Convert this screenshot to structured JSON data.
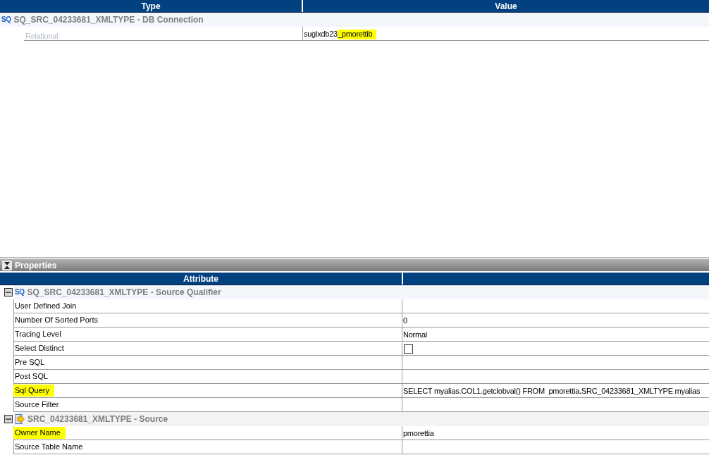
{
  "connections_panel": {
    "columns": [
      "Type",
      "Value"
    ],
    "groups": [
      {
        "kind": "qualifier",
        "icon_text": "SQ",
        "title": "SQ_SRC_04233681_XMLTYPE - DB Connection",
        "rows": [
          {
            "type": "Relational",
            "disabled": true,
            "value_parts": [
              {
                "text": "suglxdb23",
                "highlighted": false
              },
              {
                "text": "_pmorettib",
                "highlighted": true
              }
            ]
          }
        ]
      }
    ]
  },
  "properties_panel": {
    "title": "Properties",
    "columns": [
      "Attribute"
    ],
    "groups": [
      {
        "kind": "qualifier",
        "icon_text": "SQ",
        "title": "SQ_SRC_04233681_XMLTYPE - Source Qualifier",
        "expanded": true,
        "rows": [
          {
            "attribute": "User Defined Join",
            "kind": "text",
            "highlighted": false
          },
          {
            "attribute": "Number Of Sorted Ports",
            "kind": "text",
            "value": "0",
            "highlighted": false
          },
          {
            "attribute": "Tracing Level",
            "kind": "text",
            "value": "Normal",
            "highlighted": false
          },
          {
            "attribute": "Select Distinct",
            "kind": "checkbox",
            "checked": false,
            "highlighted": false
          },
          {
            "attribute": "Pre SQL",
            "kind": "text",
            "highlighted": false
          },
          {
            "attribute": "Post SQL",
            "kind": "text",
            "highlighted": false
          },
          {
            "attribute": "Sql Query",
            "kind": "text",
            "value": "SELECT myalias.COL1.getclobval() FROM  pmorettia.SRC_04233681_XMLTYPE myalias",
            "highlighted": true
          },
          {
            "attribute": "Source Filter",
            "kind": "text",
            "highlighted": false
          }
        ]
      },
      {
        "kind": "source",
        "title": "SRC_04233681_XMLTYPE - Source",
        "expanded": true,
        "rows": [
          {
            "attribute": "Owner Name",
            "kind": "text",
            "value": "pmorettia",
            "highlighted": true
          },
          {
            "attribute": "Source Table Name",
            "kind": "text",
            "highlighted": false
          }
        ]
      }
    ]
  }
}
